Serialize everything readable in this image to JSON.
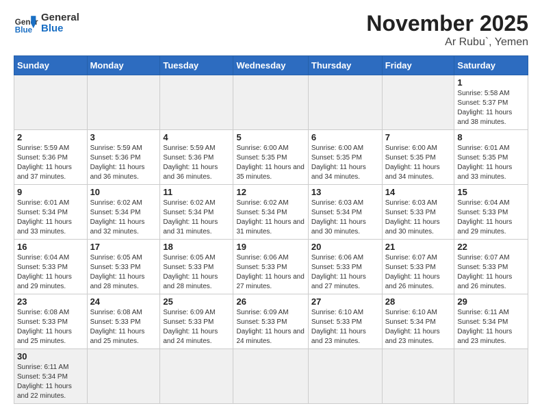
{
  "header": {
    "logo_general": "General",
    "logo_blue": "Blue",
    "title": "November 2025",
    "subtitle": "Ar Rubu`, Yemen"
  },
  "weekdays": [
    "Sunday",
    "Monday",
    "Tuesday",
    "Wednesday",
    "Thursday",
    "Friday",
    "Saturday"
  ],
  "weeks": [
    [
      {
        "day": "",
        "empty": true
      },
      {
        "day": "",
        "empty": true
      },
      {
        "day": "",
        "empty": true
      },
      {
        "day": "",
        "empty": true
      },
      {
        "day": "",
        "empty": true
      },
      {
        "day": "",
        "empty": true
      },
      {
        "day": "1",
        "sunrise": "5:58 AM",
        "sunset": "5:37 PM",
        "daylight": "11 hours and 38 minutes."
      }
    ],
    [
      {
        "day": "2",
        "sunrise": "5:59 AM",
        "sunset": "5:36 PM",
        "daylight": "11 hours and 37 minutes."
      },
      {
        "day": "3",
        "sunrise": "5:59 AM",
        "sunset": "5:36 PM",
        "daylight": "11 hours and 36 minutes."
      },
      {
        "day": "4",
        "sunrise": "5:59 AM",
        "sunset": "5:36 PM",
        "daylight": "11 hours and 36 minutes."
      },
      {
        "day": "5",
        "sunrise": "6:00 AM",
        "sunset": "5:35 PM",
        "daylight": "11 hours and 35 minutes."
      },
      {
        "day": "6",
        "sunrise": "6:00 AM",
        "sunset": "5:35 PM",
        "daylight": "11 hours and 34 minutes."
      },
      {
        "day": "7",
        "sunrise": "6:00 AM",
        "sunset": "5:35 PM",
        "daylight": "11 hours and 34 minutes."
      },
      {
        "day": "8",
        "sunrise": "6:01 AM",
        "sunset": "5:35 PM",
        "daylight": "11 hours and 33 minutes."
      }
    ],
    [
      {
        "day": "9",
        "sunrise": "6:01 AM",
        "sunset": "5:34 PM",
        "daylight": "11 hours and 33 minutes."
      },
      {
        "day": "10",
        "sunrise": "6:02 AM",
        "sunset": "5:34 PM",
        "daylight": "11 hours and 32 minutes."
      },
      {
        "day": "11",
        "sunrise": "6:02 AM",
        "sunset": "5:34 PM",
        "daylight": "11 hours and 31 minutes."
      },
      {
        "day": "12",
        "sunrise": "6:02 AM",
        "sunset": "5:34 PM",
        "daylight": "11 hours and 31 minutes."
      },
      {
        "day": "13",
        "sunrise": "6:03 AM",
        "sunset": "5:34 PM",
        "daylight": "11 hours and 30 minutes."
      },
      {
        "day": "14",
        "sunrise": "6:03 AM",
        "sunset": "5:33 PM",
        "daylight": "11 hours and 30 minutes."
      },
      {
        "day": "15",
        "sunrise": "6:04 AM",
        "sunset": "5:33 PM",
        "daylight": "11 hours and 29 minutes."
      }
    ],
    [
      {
        "day": "16",
        "sunrise": "6:04 AM",
        "sunset": "5:33 PM",
        "daylight": "11 hours and 29 minutes."
      },
      {
        "day": "17",
        "sunrise": "6:05 AM",
        "sunset": "5:33 PM",
        "daylight": "11 hours and 28 minutes."
      },
      {
        "day": "18",
        "sunrise": "6:05 AM",
        "sunset": "5:33 PM",
        "daylight": "11 hours and 28 minutes."
      },
      {
        "day": "19",
        "sunrise": "6:06 AM",
        "sunset": "5:33 PM",
        "daylight": "11 hours and 27 minutes."
      },
      {
        "day": "20",
        "sunrise": "6:06 AM",
        "sunset": "5:33 PM",
        "daylight": "11 hours and 27 minutes."
      },
      {
        "day": "21",
        "sunrise": "6:07 AM",
        "sunset": "5:33 PM",
        "daylight": "11 hours and 26 minutes."
      },
      {
        "day": "22",
        "sunrise": "6:07 AM",
        "sunset": "5:33 PM",
        "daylight": "11 hours and 26 minutes."
      }
    ],
    [
      {
        "day": "23",
        "sunrise": "6:08 AM",
        "sunset": "5:33 PM",
        "daylight": "11 hours and 25 minutes."
      },
      {
        "day": "24",
        "sunrise": "6:08 AM",
        "sunset": "5:33 PM",
        "daylight": "11 hours and 25 minutes."
      },
      {
        "day": "25",
        "sunrise": "6:09 AM",
        "sunset": "5:33 PM",
        "daylight": "11 hours and 24 minutes."
      },
      {
        "day": "26",
        "sunrise": "6:09 AM",
        "sunset": "5:33 PM",
        "daylight": "11 hours and 24 minutes."
      },
      {
        "day": "27",
        "sunrise": "6:10 AM",
        "sunset": "5:33 PM",
        "daylight": "11 hours and 23 minutes."
      },
      {
        "day": "28",
        "sunrise": "6:10 AM",
        "sunset": "5:34 PM",
        "daylight": "11 hours and 23 minutes."
      },
      {
        "day": "29",
        "sunrise": "6:11 AM",
        "sunset": "5:34 PM",
        "daylight": "11 hours and 23 minutes."
      }
    ],
    [
      {
        "day": "30",
        "sunrise": "6:11 AM",
        "sunset": "5:34 PM",
        "daylight": "11 hours and 22 minutes.",
        "last": true
      },
      {
        "day": "",
        "empty": true,
        "last": true
      },
      {
        "day": "",
        "empty": true,
        "last": true
      },
      {
        "day": "",
        "empty": true,
        "last": true
      },
      {
        "day": "",
        "empty": true,
        "last": true
      },
      {
        "day": "",
        "empty": true,
        "last": true
      },
      {
        "day": "",
        "empty": true,
        "last": true
      }
    ]
  ],
  "labels": {
    "sunrise": "Sunrise:",
    "sunset": "Sunset:",
    "daylight": "Daylight:"
  }
}
